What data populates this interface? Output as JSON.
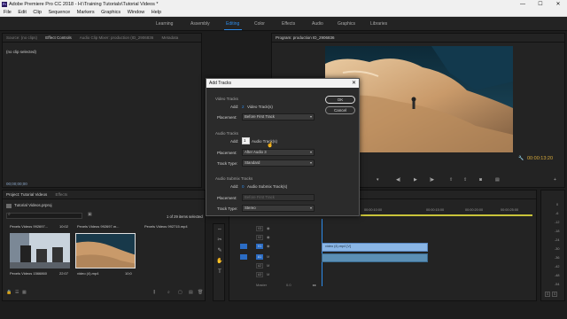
{
  "titlebar": {
    "title": "Adobe Premiere Pro CC 2018 - H:\\Training Tutorials\\Tutorial Videos *",
    "app_icon_text": "Pr",
    "minimize": "—",
    "maximize": "☐",
    "close": "✕"
  },
  "menu": [
    "File",
    "Edit",
    "Clip",
    "Sequence",
    "Markers",
    "Graphics",
    "Window",
    "Help"
  ],
  "workspaces": [
    "Learning",
    "Assembly",
    "Editing",
    "Color",
    "Effects",
    "Audio",
    "Graphics",
    "Libraries"
  ],
  "active_workspace": "Editing",
  "source_panel": {
    "tabs": [
      "Source: (no clips)",
      "Effect Controls",
      "Audio Clip Mixer: production (ID_2906836",
      "Metadata"
    ],
    "no_clip": "(no clip selected)",
    "timecode": "00;00;00;00"
  },
  "program_panel": {
    "tab": "Program: production ID_2906836",
    "timecode": "00:00:13:20"
  },
  "project_panel": {
    "tabs": [
      "Project: Tutorial Videos",
      "Effects"
    ],
    "project_name": "Tutorial Videos.prproj",
    "items_count": "1 of 29 items selected",
    "items": [
      {
        "name": "Pexels Videos 992697...",
        "duration": "10:02"
      },
      {
        "name": "Pexels Videos 992697.m...",
        "duration": ""
      },
      {
        "name": "Pexels Videos 992715.mp4",
        "duration": ""
      }
    ],
    "thumbs": [
      {
        "name": "Pexels Videos 1566860",
        "duration": "22:07"
      },
      {
        "name": "video (4).mp4",
        "duration": "10;0"
      }
    ]
  },
  "timeline_panel": {
    "tabs": [
      "...gelbeck",
      "production ID_2906877",
      "production ID_2906836"
    ],
    "ruler": [
      "00:00",
      "00:00:05:00",
      "00:00:10:00",
      "00:00:15:00",
      "00:00:20:00",
      "00:00:25:00"
    ],
    "tracks": [
      "V3",
      "V2",
      "V1",
      "A1",
      "A2",
      "A3"
    ],
    "clip_label": "video (4).mp4 [V]",
    "audio_clip_label": "",
    "master_label": "Master",
    "master_value": "0.0"
  },
  "meter": {
    "ticks": [
      "0",
      "-6",
      "-12",
      "-18",
      "-24",
      "-30",
      "-36",
      "-42",
      "-48",
      "-54"
    ],
    "solo": "S",
    "solo2": "S"
  },
  "dialog": {
    "title": "Add Tracks",
    "video_section": "Video Tracks",
    "video_add_label": "Add:",
    "video_add_value": "2",
    "video_add_unit": "Video Track(s)",
    "video_placement_label": "Placement:",
    "video_placement": "Before First Track",
    "audio_section": "Audio Tracks",
    "audio_add_label": "Add:",
    "audio_add_value": "1",
    "audio_add_unit": "Audio Track(s)",
    "audio_placement_label": "Placement:",
    "audio_placement": "After Audio 3",
    "audio_type_label": "Track Type:",
    "audio_type": "Standard",
    "submix_section": "Audio Submix Tracks",
    "submix_add_label": "Add:",
    "submix_add_value": "0",
    "submix_add_unit": "Audio Submix Track(s)",
    "submix_placement_label": "Placement:",
    "submix_placement": "Before First Track",
    "submix_type_label": "Track Type:",
    "submix_type": "Stereo",
    "ok": "OK",
    "cancel": "Cancel"
  }
}
